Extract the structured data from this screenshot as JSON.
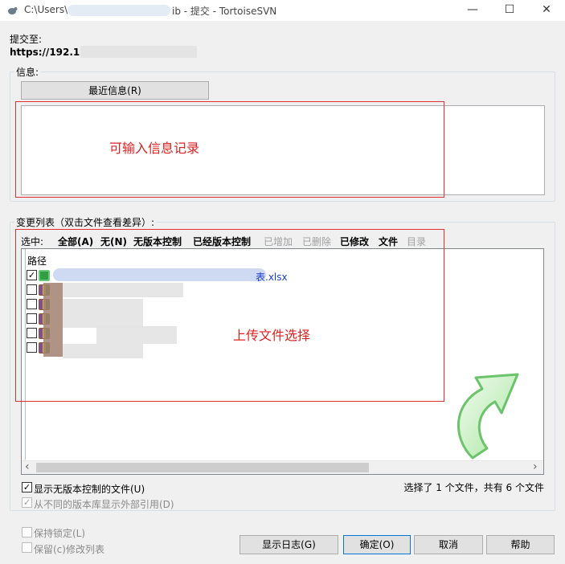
{
  "window": {
    "title_prefix": "C:\\Users\\",
    "title_suffix": "ib - 提交 - TortoiseSVN",
    "minimize_glyph": "—",
    "maximize_glyph": "☐",
    "close_glyph": "✕"
  },
  "commit_to": {
    "label": "提交至:",
    "url_visible": "https://192.1"
  },
  "message": {
    "group_label": "信息:",
    "recent_button": "最近信息(R)",
    "annotation": "可输入信息记录",
    "value": ""
  },
  "changes": {
    "group_label": "变更列表（双击文件查看差异）:",
    "select_label": "选中:",
    "filters": [
      {
        "label": "全部(A)",
        "enabled": true
      },
      {
        "label": "无(N)",
        "enabled": true
      },
      {
        "label": "无版本控制",
        "enabled": true
      },
      {
        "label": "已经版本控制",
        "enabled": true
      },
      {
        "label": "已增加",
        "enabled": false
      },
      {
        "label": "已删除",
        "enabled": false
      },
      {
        "label": "已修改",
        "enabled": true
      },
      {
        "label": "文件",
        "enabled": true
      },
      {
        "label": "目录",
        "enabled": false
      }
    ],
    "column_path": "路径",
    "files": [
      {
        "name_visible": "表.xlsx",
        "checked": true,
        "icon": "xlsx-file-icon"
      },
      {
        "name_visible": "",
        "checked": false,
        "icon": "rar-archive-icon"
      },
      {
        "name_visible": "",
        "checked": false,
        "icon": "rar-archive-icon"
      },
      {
        "name_visible": "",
        "checked": false,
        "icon": "rar-archive-icon"
      },
      {
        "name_visible": "",
        "checked": false,
        "icon": "rar-archive-icon"
      },
      {
        "name_visible": "",
        "checked": false,
        "icon": "rar-archive-icon"
      }
    ],
    "annotation": "上传文件选择",
    "scroll_left_glyph": "‹",
    "scroll_right_glyph": "›"
  },
  "options": {
    "show_unversioned": {
      "label": "显示无版本控制的文件(U)",
      "checked": true
    },
    "show_externals": {
      "label": "从不同的版本库显示外部引用(D)",
      "checked": true,
      "enabled": false
    },
    "keep_locks": {
      "label": "保持锁定(L)",
      "checked": false,
      "enabled": false
    },
    "keep_changelists": {
      "label": "保留(c)修改列表",
      "checked": false,
      "enabled": false
    }
  },
  "status": "选择了 1 个文件，共有 6 个文件",
  "buttons": {
    "show_log": "显示日志(G)",
    "ok": "确定(O)",
    "cancel": "取消",
    "help": "帮助"
  },
  "colors": {
    "annotation_red": "#e02020",
    "link_blue": "#1a3fd0"
  }
}
